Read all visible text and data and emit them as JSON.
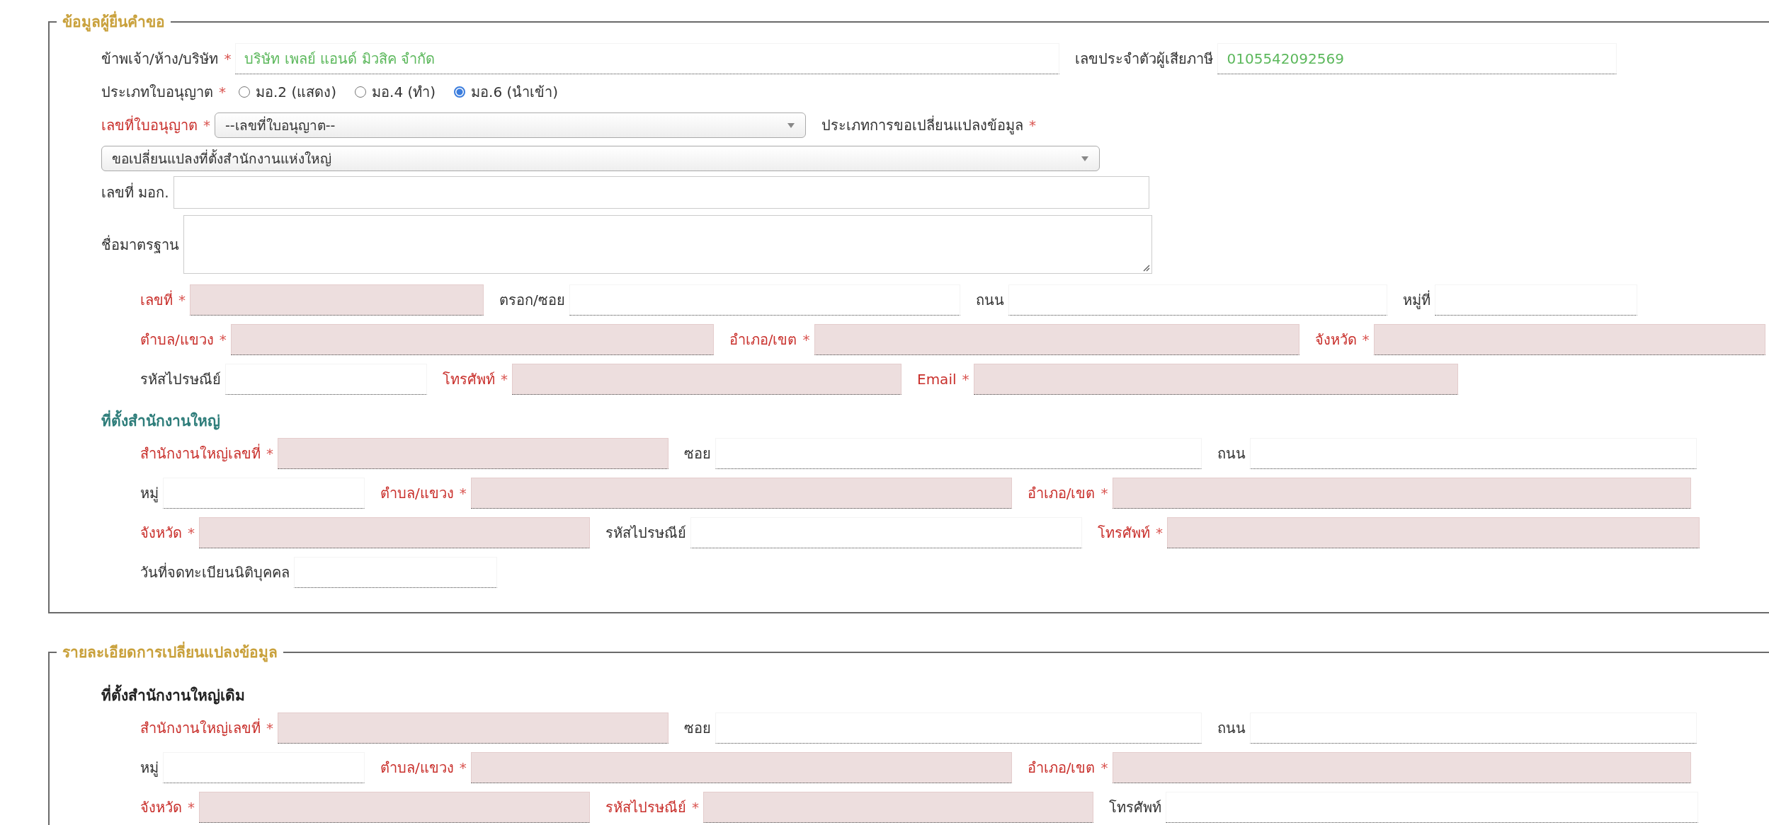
{
  "sections": [
    {
      "legend": "ข้อมูลผู้ยื่นคำขอ",
      "rows": [
        {
          "fields": [
            {
              "label": "ข้าพเจ้า/ห้าง/บริษัท",
              "mark": "*",
              "kind": "text",
              "value": "บริษัท เพลย์ แอนด์ มิวสิค จำกัด",
              "invalid": false
            },
            {
              "label": "เลขประจำตัวผู้เสียภาษี",
              "kind": "text",
              "value": "0105542092569",
              "invalid": false
            }
          ]
        },
        {
          "fields": [
            {
              "label": "ประเภทใบอนุญาต",
              "mark": "*",
              "kind": "radio",
              "invalid": false,
              "options": [
                {
                  "label": "มอ.2 (แสดง)",
                  "selected": false
                },
                {
                  "label": "มอ.4 (ทำ)",
                  "selected": false
                },
                {
                  "label": "มอ.6 (นำเข้า)",
                  "selected": true
                }
              ]
            }
          ]
        },
        {
          "fields": [
            {
              "label": "เลขที่ใบอนุญาต",
              "mark": "*",
              "kind": "select",
              "value": "--เลขที่ใบอนุญาต--",
              "invalid": true
            },
            {
              "label": "ประเภทการขอเปลี่ยนแปลงข้อมูล",
              "mark": "*",
              "kind": "label",
              "invalid": false
            }
          ]
        },
        {
          "fields": [
            {
              "kind": "select",
              "value": "ขอเปลี่ยนแปลงที่ตั้งสำนักงานแห่งใหญ่"
            }
          ]
        },
        {
          "fields": [
            {
              "label": "เลขที่ มอก.",
              "kind": "box",
              "invalid": false
            }
          ]
        },
        {
          "fields": [
            {
              "label": "ชื่อมาตรฐาน",
              "kind": "textarea",
              "invalid": false
            }
          ]
        }
      ],
      "addresses": [
        {
          "rows": [
            {
              "fields": [
                {
                  "label": "เลขที่",
                  "mark": "*",
                  "kind": "text",
                  "invalid": true
                },
                {
                  "label": "ตรอก/ซอย",
                  "kind": "text",
                  "invalid": false
                },
                {
                  "label": "ถนน",
                  "kind": "text",
                  "invalid": false
                },
                {
                  "label": "หมู่ที่",
                  "kind": "text",
                  "invalid": false
                }
              ]
            },
            {
              "fields": [
                {
                  "label": "ตำบล/แขวง",
                  "mark": "*",
                  "kind": "text",
                  "invalid": true
                },
                {
                  "label": "อำเภอ/เขต",
                  "mark": "*",
                  "kind": "text",
                  "invalid": true
                },
                {
                  "label": "จังหวัด",
                  "mark": "*",
                  "kind": "text",
                  "invalid": true
                }
              ]
            },
            {
              "fields": [
                {
                  "label": "รหัสไปรษณีย์",
                  "kind": "text",
                  "invalid": false
                },
                {
                  "label": "โทรศัพท์",
                  "mark": "*",
                  "kind": "text",
                  "invalid": true
                },
                {
                  "label": "Email",
                  "mark": "*",
                  "kind": "text",
                  "invalid": true
                }
              ]
            }
          ]
        },
        {
          "heading": "ที่ตั้งสำนักงานใหญ่",
          "kind": "accent",
          "rows": [
            {
              "fields": [
                {
                  "label": "สำนักงานใหญ่เลขที่",
                  "mark": "*",
                  "kind": "text",
                  "invalid": true
                },
                {
                  "label": "ซอย",
                  "kind": "text",
                  "invalid": false
                },
                {
                  "label": "ถนน",
                  "kind": "text",
                  "invalid": false
                }
              ]
            },
            {
              "fields": [
                {
                  "label": "หมู่",
                  "kind": "text",
                  "invalid": false
                },
                {
                  "label": "ตำบล/แขวง",
                  "mark": "*",
                  "kind": "text",
                  "invalid": true
                },
                {
                  "label": "อำเภอ/เขต",
                  "mark": "*",
                  "kind": "text",
                  "invalid": true
                }
              ]
            },
            {
              "fields": [
                {
                  "label": "จังหวัด",
                  "mark": "*",
                  "kind": "text",
                  "invalid": true
                },
                {
                  "label": "รหัสไปรษณีย์",
                  "kind": "text",
                  "invalid": false
                },
                {
                  "label": "โทรศัพท์",
                  "mark": "*",
                  "kind": "text",
                  "invalid": true
                }
              ]
            },
            {
              "fields": [
                {
                  "label": "วันที่จดทะเบียนนิติบุคคล",
                  "kind": "text",
                  "invalid": false
                }
              ]
            }
          ]
        }
      ]
    },
    {
      "legend": "รายละเอียดการเปลี่ยนแปลงข้อมูล",
      "addresses": [
        {
          "heading": "ที่ตั้งสำนักงานใหญ่เดิม",
          "kind": "plain",
          "rows": [
            {
              "fields": [
                {
                  "label": "สำนักงานใหญ่เลขที่",
                  "mark": "*",
                  "kind": "text",
                  "invalid": true
                },
                {
                  "label": "ซอย",
                  "kind": "text",
                  "invalid": false
                },
                {
                  "label": "ถนน",
                  "kind": "text",
                  "invalid": false
                }
              ]
            },
            {
              "fields": [
                {
                  "label": "หมู่",
                  "kind": "text",
                  "invalid": false
                },
                {
                  "label": "ตำบล/แขวง",
                  "mark": "*",
                  "kind": "text",
                  "invalid": true
                },
                {
                  "label": "อำเภอ/เขต",
                  "mark": "*",
                  "kind": "text",
                  "invalid": true
                }
              ]
            },
            {
              "fields": [
                {
                  "label": "จังหวัด",
                  "mark": "*",
                  "kind": "text",
                  "invalid": true
                },
                {
                  "label": "รหัสไปรษณีย์",
                  "mark": "*",
                  "kind": "text",
                  "invalid": true
                },
                {
                  "label": "โทรศัพท์",
                  "kind": "text",
                  "invalid": false
                }
              ]
            }
          ]
        }
      ]
    }
  ]
}
